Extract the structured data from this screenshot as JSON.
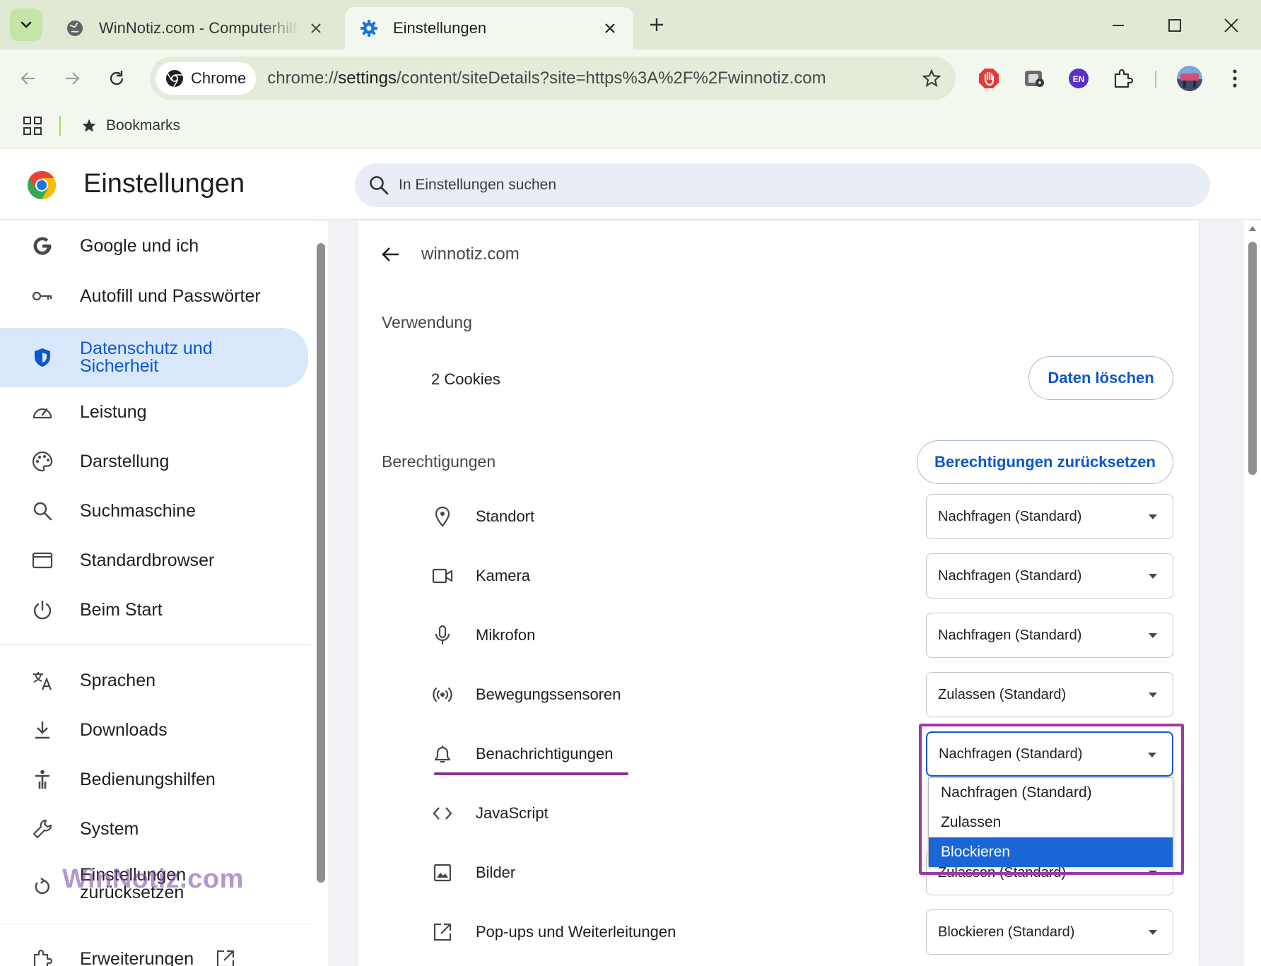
{
  "tabs": {
    "inactive": {
      "title": "WinNotiz.com - Computerhilfe und"
    },
    "active": {
      "title": "Einstellungen"
    }
  },
  "toolbar": {
    "chip_label": "Chrome",
    "url_prefix": "chrome://",
    "url_host": "settings",
    "url_rest": "/content/siteDetails?site=https%3A%2F%2Fwinnotiz.com",
    "extensions": [
      "adblock-icon",
      "screenshot-extension-icon",
      "language-extension-icon",
      "extensions-puzzle-icon"
    ],
    "language_badge": "EN"
  },
  "bookmarks": {
    "label": "Bookmarks"
  },
  "header": {
    "title": "Einstellungen",
    "search_placeholder": "In Einstellungen suchen"
  },
  "sidebar": {
    "items": [
      {
        "label": "Google und ich",
        "icon": "google-g-icon"
      },
      {
        "label": "Autofill und Passwörter",
        "icon": "key-icon"
      },
      {
        "label_line1": "Datenschutz und",
        "label_line2": "Sicherheit",
        "icon": "shield-icon",
        "active": true
      },
      {
        "label": "Leistung",
        "icon": "gauge-icon"
      },
      {
        "label": "Darstellung",
        "icon": "palette-icon"
      },
      {
        "label": "Suchmaschine",
        "icon": "search-icon"
      },
      {
        "label": "Standardbrowser",
        "icon": "browser-window-icon"
      },
      {
        "label": "Beim Start",
        "icon": "power-icon"
      },
      {
        "label": "Sprachen",
        "icon": "translate-icon"
      },
      {
        "label": "Downloads",
        "icon": "download-icon"
      },
      {
        "label": "Bedienungshilfen",
        "icon": "accessibility-icon"
      },
      {
        "label": "System",
        "icon": "wrench-icon"
      },
      {
        "label_line1": "Einstellungen",
        "label_line2": "zurücksetzen",
        "icon": "reset-icon"
      },
      {
        "label": "Erweiterungen",
        "icon": "puzzle-icon"
      }
    ],
    "watermark": "WinNotiz.com"
  },
  "site": {
    "name": "winnotiz.com",
    "usage_title": "Verwendung",
    "cookies": "2 Cookies",
    "delete_button": "Daten löschen",
    "permissions_title": "Berechtigungen",
    "reset_button": "Berechtigungen zurücksetzen",
    "permissions": [
      {
        "label": "Standort",
        "value": "Nachfragen (Standard)",
        "icon": "location-pin-icon"
      },
      {
        "label": "Kamera",
        "value": "Nachfragen (Standard)",
        "icon": "camera-icon"
      },
      {
        "label": "Mikrofon",
        "value": "Nachfragen (Standard)",
        "icon": "microphone-icon"
      },
      {
        "label": "Bewegungssensoren",
        "value": "Zulassen (Standard)",
        "icon": "motion-sensor-icon"
      },
      {
        "label": "Benachrichtigungen",
        "value": "Nachfragen (Standard)",
        "icon": "bell-icon"
      },
      {
        "label": "JavaScript",
        "value": "",
        "icon": "code-icon"
      },
      {
        "label": "Bilder",
        "value": "Zulassen (Standard)",
        "icon": "image-icon"
      },
      {
        "label": "Pop-ups und Weiterleitungen",
        "value": "Blockieren (Standard)",
        "icon": "external-link-icon"
      }
    ],
    "dropdown_options": [
      "Nachfragen (Standard)",
      "Zulassen",
      "Blockieren"
    ],
    "dropdown_selected": "Blockieren"
  },
  "colors": {
    "accent": "#0b57d0",
    "active_nav_bg": "#d9e7fb",
    "highlight": "#9a3aa5",
    "tabstrip": "#dfe9d3"
  }
}
